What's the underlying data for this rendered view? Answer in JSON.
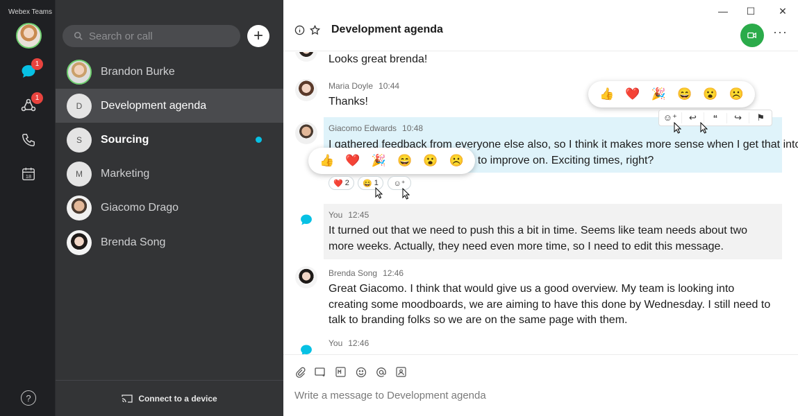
{
  "app": {
    "title": "Webex Teams"
  },
  "rail": {
    "messaging_badge": "1",
    "teams_badge": "1",
    "calendar_day": "18"
  },
  "sidebar": {
    "search_placeholder": "Search or call",
    "spaces": [
      {
        "name": "Brandon Burke",
        "initial": "",
        "bold": false
      },
      {
        "name": "Development agenda",
        "initial": "D",
        "bold": false
      },
      {
        "name": "Sourcing",
        "initial": "S",
        "bold": true,
        "unread": true
      },
      {
        "name": "Marketing",
        "initial": "M",
        "bold": false
      },
      {
        "name": "Giacomo Drago",
        "initial": "",
        "bold": false
      },
      {
        "name": "Brenda Song",
        "initial": "",
        "bold": false
      }
    ],
    "footer_label": "Connect to a device"
  },
  "header": {
    "title": "Development agenda"
  },
  "messages": [
    {
      "sender": "",
      "time": "",
      "text": "Looks great brenda!"
    },
    {
      "sender": "Maria Doyle",
      "time": "10:44",
      "text": "Thanks!"
    },
    {
      "sender": "Giacomo Edwards",
      "time": "10:48",
      "text_line1": "I gathered feedback from everyone else also, so I think it makes more sense when I get that into",
      "text_line2": "t to improve on. Exciting times, right?"
    },
    {
      "sender": "You",
      "time": "12:45",
      "text": "It turned out that we need to push this a bit in time. Seems like team needs about two more weeks. Actually, they need even more time, so I need to edit this message."
    },
    {
      "sender": "Brenda Song",
      "time": "12:46",
      "text": "Great Giacomo. I think that would give us a good overview. My team is looking into creating some moodboards, we are aiming to have this done by Wednesday. I still need to talk to branding folks so we are on the same page with them."
    },
    {
      "sender": "You",
      "time": "12:46",
      "text": ""
    }
  ],
  "reactions": {
    "emojis": [
      "👍",
      "❤️",
      "🎉",
      "😄",
      "😮",
      "☹️"
    ],
    "heart_count": "2",
    "smile_count": "1"
  },
  "composer": {
    "placeholder": "Write a message to Development agenda"
  },
  "colors": {
    "accent": "#07c1e4",
    "highlight": "#dff3fa",
    "self_bg": "#f2f2f2",
    "meet": "#2bab4a"
  }
}
